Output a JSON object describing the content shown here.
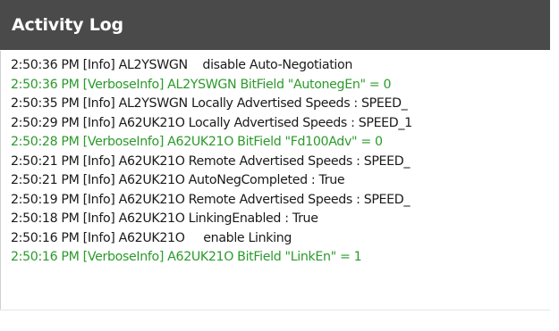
{
  "panel": {
    "title": "Activity Log"
  },
  "log": {
    "entries": [
      {
        "text": "2:50:36 PM [Info] AL2YSWGN    disable Auto-Negotiation",
        "level": "Info"
      },
      {
        "text": "2:50:36 PM [VerboseInfo] AL2YSWGN BitField \"AutonegEn\" = 0",
        "level": "VerboseInfo"
      },
      {
        "text": "2:50:35 PM [Info] AL2YSWGN Locally Advertised Speeds : SPEED_",
        "level": "Info"
      },
      {
        "text": "2:50:29 PM [Info] A62UK21O Locally Advertised Speeds : SPEED_1",
        "level": "Info"
      },
      {
        "text": "2:50:28 PM [VerboseInfo] A62UK21O BitField \"Fd100Adv\" = 0",
        "level": "VerboseInfo"
      },
      {
        "text": "2:50:21 PM [Info] A62UK21O Remote Advertised Speeds : SPEED_",
        "level": "Info"
      },
      {
        "text": "2:50:21 PM [Info] A62UK21O AutoNegCompleted : True",
        "level": "Info"
      },
      {
        "text": "2:50:19 PM [Info] A62UK21O Remote Advertised Speeds : SPEED_",
        "level": "Info"
      },
      {
        "text": "2:50:18 PM [Info] A62UK21O LinkingEnabled : True",
        "level": "Info"
      },
      {
        "text": "2:50:16 PM [Info] A62UK21O     enable Linking",
        "level": "Info"
      },
      {
        "text": "2:50:16 PM [VerboseInfo] A62UK21O BitField \"LinkEn\" = 1",
        "level": "VerboseInfo"
      }
    ]
  },
  "colors": {
    "header_background": "#4a4a4a",
    "header_text": "#ffffff",
    "info_text": "#1a1a1a",
    "verbose_text": "#2b9a2b"
  }
}
